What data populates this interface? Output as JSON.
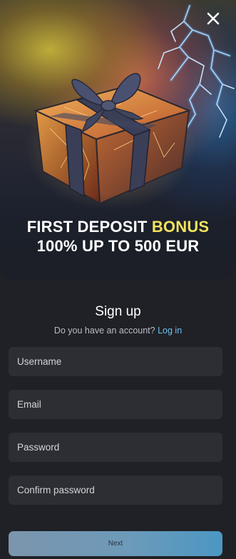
{
  "promo": {
    "headline_prefix": "FIRST DEPOSIT ",
    "headline_accent": "BONUS",
    "headline_line2": "100% UP TO 500 EUR",
    "accent_color": "#f2e25c"
  },
  "close": {
    "icon": "close-icon"
  },
  "signup": {
    "title": "Sign up",
    "account_question": "Do you have an account? ",
    "login_link": "Log in"
  },
  "form": {
    "username_placeholder": "Username",
    "email_placeholder": "Email",
    "password_placeholder": "Password",
    "confirm_password_placeholder": "Confirm password",
    "next_label": "Next"
  },
  "colors": {
    "background": "#1f2126",
    "field_background": "#2c2e33",
    "link": "#6cc2ef",
    "button_gradient_start": "#7c95ad",
    "button_gradient_end": "#4b97c4"
  }
}
